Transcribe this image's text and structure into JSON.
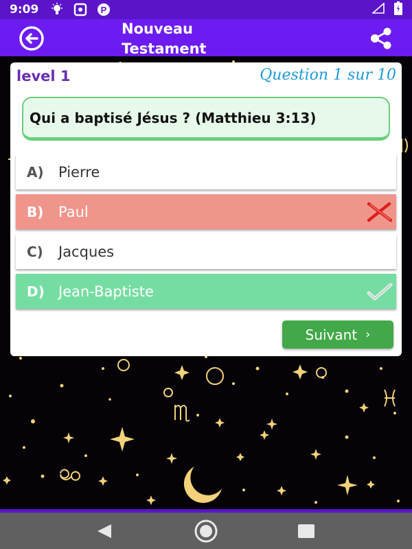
{
  "status_bar": {
    "time": "9:09",
    "icons": [
      "lightbulb-icon",
      "screenshot-icon",
      "parking-icon"
    ],
    "right_icons": [
      "signal-icon",
      "battery-icon"
    ]
  },
  "app_bar": {
    "title": "Nouveau\nTestament",
    "back_icon": "arrow-left-circle-icon",
    "share_icon": "share-icon"
  },
  "quiz": {
    "level": "level 1",
    "question_count": "Question 1 sur 10",
    "question": "Qui a baptisé Jésus ? (Matthieu 3:13)",
    "options": [
      {
        "letter": "A)",
        "text": "Pierre",
        "state": "plain"
      },
      {
        "letter": "B)",
        "text": "Paul",
        "state": "wrong"
      },
      {
        "letter": "C)",
        "text": "Jacques",
        "state": "plain"
      },
      {
        "letter": "D)",
        "text": "Jean-Baptiste",
        "state": "right"
      }
    ],
    "next_label": "Suivant",
    "next_icon": "chevron-right-icon"
  },
  "colors": {
    "status_bar": "#5b14c9",
    "app_bar": "#6c1cf0",
    "wrong": "#f0958c",
    "right": "#76dda2",
    "next_button": "#43a84a",
    "stars": "#f3d27a"
  },
  "nav_bar": {
    "icons": [
      "back-triangle-icon",
      "home-circle-icon",
      "recents-square-icon"
    ]
  }
}
